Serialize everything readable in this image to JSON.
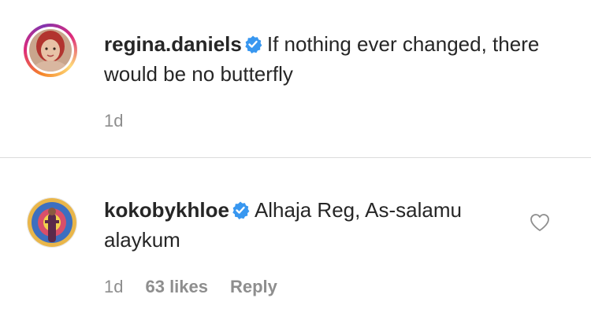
{
  "caption": {
    "username": "regina.daniels",
    "text": "If nothing ever changed, there would be no butterfly",
    "time": "1d"
  },
  "comment": {
    "username": "kokobykhloe",
    "text": "Alhaja Reg, As-salamu alaykum",
    "time": "1d",
    "likes": "63 likes",
    "reply_label": "Reply"
  },
  "icons": {
    "verified": "verified-badge-icon",
    "like": "heart-outline-icon"
  },
  "colors": {
    "verified_blue": "#3897f0",
    "meta_gray": "#8e8e8e",
    "divider": "#dbdbdb"
  }
}
